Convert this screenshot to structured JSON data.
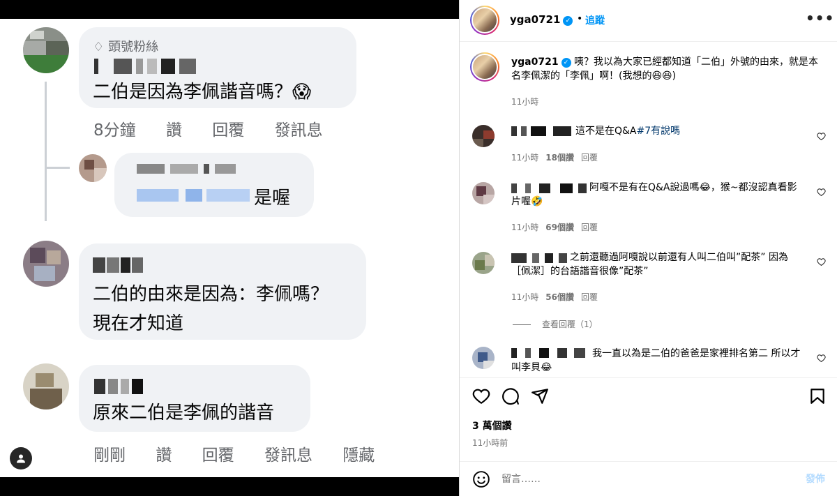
{
  "media": {
    "comment1": {
      "badge": "頭號粉絲",
      "text": "二伯是因為李佩諧音嗎？😱",
      "meta": [
        "8分鐘",
        "讚",
        "回覆",
        "發訊息"
      ]
    },
    "reply1": {
      "text": "是喔"
    },
    "comment2": {
      "line1": "二伯的由來是因為：李佩嗎？",
      "line2": "現在才知道"
    },
    "comment3": {
      "text": "原來二伯是李佩的諧音",
      "meta": [
        "剛剛",
        "讚",
        "回覆",
        "發訊息",
        "隱藏"
      ]
    }
  },
  "header": {
    "username": "yga0721",
    "separator": "•",
    "follow_label": "追蹤",
    "more": "•••"
  },
  "caption": {
    "username": "yga0721",
    "text": "咦？我以為大家已經都知道「二伯」外號的由來，就是本名李佩潔的「李佩」啊！(我想的😆😆)",
    "time": "11小時"
  },
  "comments": [
    {
      "text": "這不是在Q&A",
      "hashtag": "#7有說嗎",
      "time": "11小時",
      "likes": "18個讚",
      "reply": "回覆"
    },
    {
      "text": "阿嘎不是有在Q&A說過嗎😂，猴~都沒認真看影片喔🤣",
      "time": "11小時",
      "likes": "69個讚",
      "reply": "回覆"
    },
    {
      "text": "之前還聽過阿嘎說以前還有人叫二伯叫”配茶” 因為［佩潔］的台語諧音很像”配茶”",
      "time": "11小時",
      "likes": "56個讚",
      "reply": "回覆",
      "view_replies": "查看回覆（1）"
    },
    {
      "text": "我一直以為是二伯的爸爸是家裡排名第二 所以才叫李貝😂"
    }
  ],
  "actions": {
    "likes": "3 萬個讚",
    "posted": "11小時前"
  },
  "add_comment": {
    "placeholder": "留言……",
    "post_label": "發佈"
  },
  "colors": {
    "accent": "#0095f6",
    "muted": "#737373",
    "bubble": "#f0f2f5"
  }
}
